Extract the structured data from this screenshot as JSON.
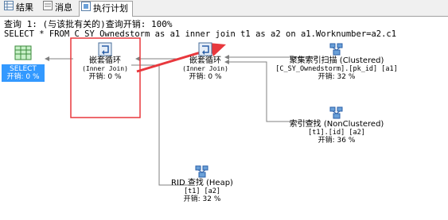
{
  "tabs": [
    {
      "label": "结果",
      "icon": "grid-icon"
    },
    {
      "label": "消息",
      "icon": "message-icon"
    },
    {
      "label": "执行计划",
      "icon": "execution-plan-icon",
      "active": true
    }
  ],
  "query_header": "查询 1: (与该批有关的)查询开销: 100%",
  "query_sql": "SELECT * FROM C_SY_Ownedstorm as a1 inner join t1 as a2 on a1.Worknumber=a2.c1",
  "nodes": {
    "select": {
      "name": "SELECT",
      "cost": "开销: 0 %"
    },
    "nested_loop_1": {
      "name": "嵌套循环",
      "sub": "(Inner Join)",
      "cost": "开销: 0 %"
    },
    "nested_loop_2": {
      "name": "嵌套循环",
      "sub": "(Inner Join)",
      "cost": "开销: 0 %"
    },
    "clustered_scan": {
      "name": "聚集索引扫描 (Clustered)",
      "object": "[C_SY_Ownedstorm].[pk_id] [a1]",
      "cost": "开销: 32 %"
    },
    "index_seek": {
      "name": "索引查找 (NonClustered)",
      "object": "[t1].[id] [a2]",
      "cost": "开销: 36 %"
    },
    "rid_lookup": {
      "name": "RID 查找 (Heap)",
      "object": "[t1] [a2]",
      "cost": "开销: 32 %"
    }
  },
  "colors": {
    "annotation": "#e8383d",
    "select_bg": "#3399ff",
    "connector": "#808080"
  }
}
